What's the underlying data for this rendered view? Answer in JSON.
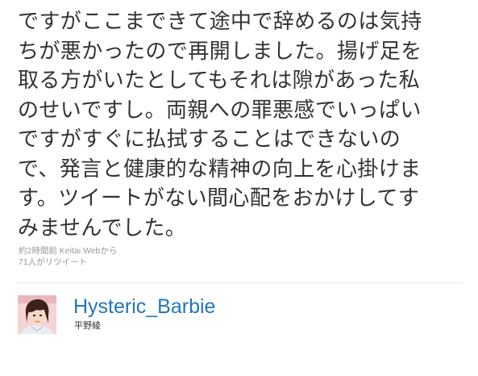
{
  "tweet": {
    "lines": [
      "ですがここまできて途中で辞めるのは気持",
      "ちが悪かったので再開しました。揚げ足を",
      "取る方がいたとしてもそれは隙があった私",
      "のせいですし。両親への罪悪感でいっぱい",
      "ですがすぐに払拭することはできないの",
      "で、発言と健康的な精神の向上を心掛けま",
      "す。ツイートがない間心配をおかけしてす",
      "みませんでした。"
    ],
    "timestamp": "約2時間前",
    "source": "Keitai Webから",
    "retweets": "71人がリツイート"
  },
  "user": {
    "screen_name": "Hysteric_Barbie",
    "full_name": "平野綾",
    "avatar_icon": "user-avatar-photo",
    "link_color": "#2276bb"
  }
}
